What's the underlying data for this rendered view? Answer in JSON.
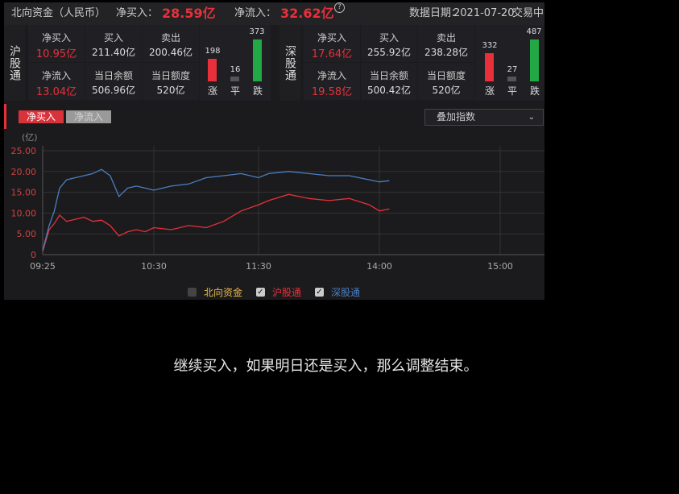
{
  "header": {
    "title": "北向资金（人民币）",
    "net_buy_label": "净买入：",
    "net_buy_value": "28.59亿",
    "net_inflow_label": "净流入：",
    "net_inflow_value": "32.62亿",
    "help": "?",
    "date_label": "数据日期：",
    "date_value": "2021-07-20",
    "status": "交易中"
  },
  "sh": {
    "market": "沪股通",
    "net_buy_label": "净买入",
    "net_buy": "10.95亿",
    "buy_label": "买入",
    "buy": "211.40亿",
    "sell_label": "卖出",
    "sell": "200.46亿",
    "net_inflow_label": "净流入",
    "net_inflow": "13.04亿",
    "balance_label": "当日余额",
    "balance": "506.96亿",
    "quota_label": "当日额度",
    "quota": "520亿",
    "up_count": 198,
    "flat_count": 16,
    "down_count": 373,
    "up_label": "涨",
    "flat_label": "平",
    "down_label": "跌"
  },
  "sz": {
    "market": "深股通",
    "net_buy_label": "净买入",
    "net_buy": "17.64亿",
    "buy_label": "买入",
    "buy": "255.92亿",
    "sell_label": "卖出",
    "sell": "238.28亿",
    "net_inflow_label": "净流入",
    "net_inflow": "19.58亿",
    "balance_label": "当日余额",
    "balance": "500.42亿",
    "quota_label": "当日额度",
    "quota": "520亿",
    "up_count": 332,
    "flat_count": 27,
    "down_count": 487,
    "up_label": "涨",
    "flat_label": "平",
    "down_label": "跌"
  },
  "tabs": {
    "active": "净买入",
    "inactive": "净流入"
  },
  "overlay": {
    "label": "叠加指数"
  },
  "legend": {
    "north": "北向资金",
    "sh": "沪股通",
    "sz": "深股通",
    "north_checked": false,
    "sh_checked": true,
    "sz_checked": true
  },
  "colors": {
    "up": "#e8303a",
    "flat": "#555555",
    "down": "#22a845",
    "sh_line": "#e8303a",
    "sz_line": "#4a7fc1",
    "north_label": "#e8b84a"
  },
  "caption": "继续买入，如果明日还是买入，那么调整结束。",
  "chart_data": {
    "type": "line",
    "ylabel": "(亿)",
    "ylim": [
      0,
      25
    ],
    "yticks": [
      "25.00",
      "20.00",
      "15.00",
      "10.00",
      "5.00",
      "0"
    ],
    "xticks": [
      "09:25",
      "10:30",
      "11:30",
      "14:00",
      "15:00"
    ],
    "x": [
      "09:25",
      "09:30",
      "09:33",
      "09:36",
      "09:40",
      "09:45",
      "09:50",
      "09:55",
      "10:00",
      "10:05",
      "10:10",
      "10:15",
      "10:20",
      "10:25",
      "10:30",
      "10:40",
      "10:50",
      "11:00",
      "11:10",
      "11:20",
      "11:30",
      "13:05",
      "13:15",
      "13:25",
      "13:35",
      "13:45",
      "13:55",
      "14:00",
      "14:05"
    ],
    "series": [
      {
        "name": "沪股通",
        "values": [
          0.8,
          6.0,
          7.5,
          9.5,
          8.0,
          8.5,
          9.0,
          8.0,
          8.3,
          7.0,
          4.5,
          5.5,
          6.0,
          5.5,
          6.5,
          6.0,
          7.0,
          6.5,
          8.0,
          10.5,
          12.0,
          13.0,
          14.5,
          13.5,
          13.0,
          13.5,
          12.0,
          10.5,
          11.0
        ]
      },
      {
        "name": "深股通",
        "values": [
          1.0,
          7.0,
          10.5,
          16.0,
          18.0,
          18.5,
          19.0,
          19.5,
          20.5,
          19.0,
          14.0,
          16.0,
          16.5,
          16.0,
          15.5,
          16.5,
          17.0,
          18.5,
          19.0,
          19.5,
          18.5,
          19.5,
          20.0,
          19.5,
          19.0,
          19.0,
          18.0,
          17.5,
          17.8
        ]
      }
    ]
  }
}
